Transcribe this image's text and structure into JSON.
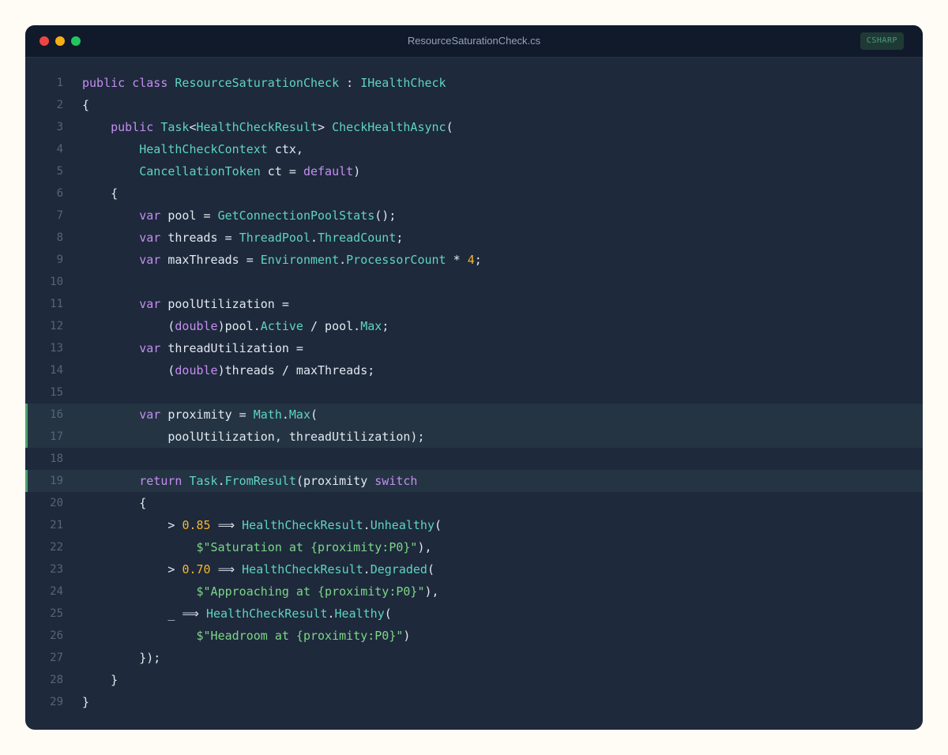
{
  "window": {
    "filename": "ResourceSaturationCheck.cs",
    "language": "CSHARP"
  },
  "colors": {
    "keyword": "#c48ef0",
    "type": "#5fd3c6",
    "number": "#f5b72e",
    "string": "#7dd68a",
    "plain": "#e2e8f0",
    "line_number": "#56657a",
    "highlight_marker": "#4f9e6e"
  },
  "code": {
    "highlighted_lines": [
      16,
      17,
      19
    ],
    "lines": [
      {
        "n": "1",
        "tokens": [
          [
            "k",
            "public"
          ],
          [
            "p",
            " "
          ],
          [
            "k",
            "class"
          ],
          [
            "p",
            " "
          ],
          [
            "t",
            "ResourceSaturationCheck"
          ],
          [
            "p",
            " : "
          ],
          [
            "t",
            "IHealthCheck"
          ]
        ]
      },
      {
        "n": "2",
        "tokens": [
          [
            "p",
            "{"
          ]
        ]
      },
      {
        "n": "3",
        "tokens": [
          [
            "p",
            "    "
          ],
          [
            "k",
            "public"
          ],
          [
            "p",
            " "
          ],
          [
            "t",
            "Task"
          ],
          [
            "p",
            "<"
          ],
          [
            "t",
            "HealthCheckResult"
          ],
          [
            "p",
            "> "
          ],
          [
            "t",
            "CheckHealthAsync"
          ],
          [
            "p",
            "("
          ]
        ]
      },
      {
        "n": "4",
        "tokens": [
          [
            "p",
            "        "
          ],
          [
            "t",
            "HealthCheckContext"
          ],
          [
            "p",
            " ctx,"
          ]
        ]
      },
      {
        "n": "5",
        "tokens": [
          [
            "p",
            "        "
          ],
          [
            "t",
            "CancellationToken"
          ],
          [
            "p",
            " ct = "
          ],
          [
            "k",
            "default"
          ],
          [
            "p",
            ")"
          ]
        ]
      },
      {
        "n": "6",
        "tokens": [
          [
            "p",
            "    {"
          ]
        ]
      },
      {
        "n": "7",
        "tokens": [
          [
            "p",
            "        "
          ],
          [
            "k",
            "var"
          ],
          [
            "p",
            " pool = "
          ],
          [
            "t",
            "GetConnectionPoolStats"
          ],
          [
            "p",
            "();"
          ]
        ]
      },
      {
        "n": "8",
        "tokens": [
          [
            "p",
            "        "
          ],
          [
            "k",
            "var"
          ],
          [
            "p",
            " threads = "
          ],
          [
            "t",
            "ThreadPool"
          ],
          [
            "p",
            "."
          ],
          [
            "t",
            "ThreadCount"
          ],
          [
            "p",
            ";"
          ]
        ]
      },
      {
        "n": "9",
        "tokens": [
          [
            "p",
            "        "
          ],
          [
            "k",
            "var"
          ],
          [
            "p",
            " maxThreads = "
          ],
          [
            "t",
            "Environment"
          ],
          [
            "p",
            "."
          ],
          [
            "t",
            "ProcessorCount"
          ],
          [
            "p",
            " * "
          ],
          [
            "n",
            "4"
          ],
          [
            "p",
            ";"
          ]
        ]
      },
      {
        "n": "10",
        "tokens": []
      },
      {
        "n": "11",
        "tokens": [
          [
            "p",
            "        "
          ],
          [
            "k",
            "var"
          ],
          [
            "p",
            " poolUtilization ="
          ]
        ]
      },
      {
        "n": "12",
        "tokens": [
          [
            "p",
            "            ("
          ],
          [
            "k",
            "double"
          ],
          [
            "p",
            ")pool."
          ],
          [
            "t",
            "Active"
          ],
          [
            "p",
            " / pool."
          ],
          [
            "t",
            "Max"
          ],
          [
            "p",
            ";"
          ]
        ]
      },
      {
        "n": "13",
        "tokens": [
          [
            "p",
            "        "
          ],
          [
            "k",
            "var"
          ],
          [
            "p",
            " threadUtilization ="
          ]
        ]
      },
      {
        "n": "14",
        "tokens": [
          [
            "p",
            "            ("
          ],
          [
            "k",
            "double"
          ],
          [
            "p",
            ")threads / maxThreads;"
          ]
        ]
      },
      {
        "n": "15",
        "tokens": []
      },
      {
        "n": "16",
        "tokens": [
          [
            "p",
            "        "
          ],
          [
            "k",
            "var"
          ],
          [
            "p",
            " proximity = "
          ],
          [
            "t",
            "Math"
          ],
          [
            "p",
            "."
          ],
          [
            "t",
            "Max"
          ],
          [
            "p",
            "("
          ]
        ]
      },
      {
        "n": "17",
        "tokens": [
          [
            "p",
            "            poolUtilization, threadUtilization);"
          ]
        ]
      },
      {
        "n": "18",
        "tokens": []
      },
      {
        "n": "19",
        "tokens": [
          [
            "p",
            "        "
          ],
          [
            "k",
            "return"
          ],
          [
            "p",
            " "
          ],
          [
            "t",
            "Task"
          ],
          [
            "p",
            "."
          ],
          [
            "t",
            "FromResult"
          ],
          [
            "p",
            "(proximity "
          ],
          [
            "k",
            "switch"
          ]
        ]
      },
      {
        "n": "20",
        "tokens": [
          [
            "p",
            "        {"
          ]
        ]
      },
      {
        "n": "21",
        "tokens": [
          [
            "p",
            "            > "
          ],
          [
            "n",
            "0.85"
          ],
          [
            "p",
            " ⟹ "
          ],
          [
            "t",
            "HealthCheckResult"
          ],
          [
            "p",
            "."
          ],
          [
            "t",
            "Unhealthy"
          ],
          [
            "p",
            "("
          ]
        ]
      },
      {
        "n": "22",
        "tokens": [
          [
            "p",
            "                "
          ],
          [
            "s",
            "$\"Saturation at {proximity:P0}\""
          ],
          [
            "p",
            "),"
          ]
        ]
      },
      {
        "n": "23",
        "tokens": [
          [
            "p",
            "            > "
          ],
          [
            "n",
            "0.70"
          ],
          [
            "p",
            " ⟹ "
          ],
          [
            "t",
            "HealthCheckResult"
          ],
          [
            "p",
            "."
          ],
          [
            "t",
            "Degraded"
          ],
          [
            "p",
            "("
          ]
        ]
      },
      {
        "n": "24",
        "tokens": [
          [
            "p",
            "                "
          ],
          [
            "s",
            "$\"Approaching at {proximity:P0}\""
          ],
          [
            "p",
            "),"
          ]
        ]
      },
      {
        "n": "25",
        "tokens": [
          [
            "p",
            "            _ ⟹ "
          ],
          [
            "t",
            "HealthCheckResult"
          ],
          [
            "p",
            "."
          ],
          [
            "t",
            "Healthy"
          ],
          [
            "p",
            "("
          ]
        ]
      },
      {
        "n": "26",
        "tokens": [
          [
            "p",
            "                "
          ],
          [
            "s",
            "$\"Headroom at {proximity:P0}\""
          ],
          [
            "p",
            ")"
          ]
        ]
      },
      {
        "n": "27",
        "tokens": [
          [
            "p",
            "        });"
          ]
        ]
      },
      {
        "n": "28",
        "tokens": [
          [
            "p",
            "    }"
          ]
        ]
      },
      {
        "n": "29",
        "tokens": [
          [
            "p",
            "}"
          ]
        ]
      }
    ]
  }
}
